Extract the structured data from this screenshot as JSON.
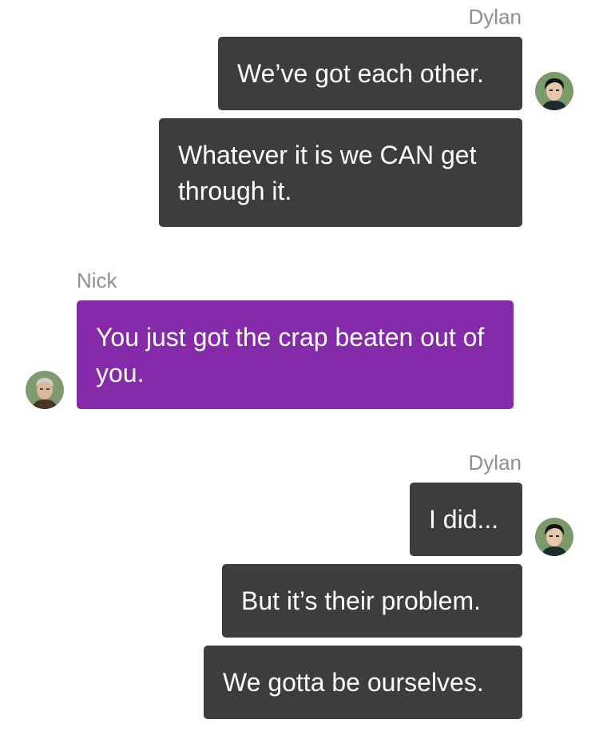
{
  "colors": {
    "outgoing_bubble": "#3d3d3d",
    "incoming_bubble": "#852aa8",
    "sender_name": "#8e8e93",
    "bubble_text": "#ffffff"
  },
  "groups": [
    {
      "sender": "Dylan",
      "side": "right",
      "avatar": "dylan-avatar-icon",
      "messages": [
        "We’ve got each other.",
        "Whatever it is we CAN get through it."
      ]
    },
    {
      "sender": "Nick",
      "side": "left",
      "avatar": "nick-avatar-icon",
      "messages": [
        "You just got the crap beaten out of you."
      ]
    },
    {
      "sender": "Dylan",
      "side": "right",
      "avatar": "dylan-avatar-icon",
      "messages": [
        "I did...",
        "But it’s their problem.",
        "We gotta be ourselves."
      ]
    }
  ]
}
